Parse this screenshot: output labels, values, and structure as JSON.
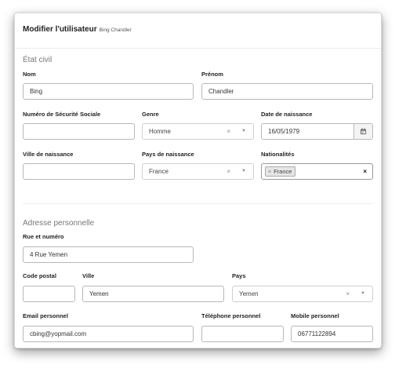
{
  "header": {
    "title": "Modifier l'utilisateur",
    "subtitle": "Bing Chandler"
  },
  "etat_civil": {
    "section_title": "État civil",
    "nom": {
      "label": "Nom",
      "value": "Bing"
    },
    "prenom": {
      "label": "Prénom",
      "value": "Chandler"
    },
    "secu": {
      "label": "Numéro de Sécurité Sociale",
      "value": ""
    },
    "genre": {
      "label": "Genre",
      "value": "Homme",
      "clear": "×",
      "arrow": "▼"
    },
    "date_naissance": {
      "label": "Date de naissance",
      "value": "16/05/1979",
      "icon": "calendar-icon"
    },
    "ville_naissance": {
      "label": "Ville de naissance",
      "value": ""
    },
    "pays_naissance": {
      "label": "Pays de naissance",
      "value": "France",
      "clear": "×",
      "arrow": "▼"
    },
    "nationalites": {
      "label": "Nationalités",
      "tags": [
        "France"
      ],
      "tag_remove": "×",
      "clear_all": "×"
    }
  },
  "adresse": {
    "section_title": "Adresse personnelle",
    "rue": {
      "label": "Rue et numéro",
      "value": "4 Rue Yemen"
    },
    "code_postal": {
      "label": "Code postal",
      "value": ""
    },
    "ville": {
      "label": "Ville",
      "value": "Yemen"
    },
    "pays": {
      "label": "Pays",
      "value": "Yemen",
      "clear": "×",
      "arrow": "▼"
    },
    "email": {
      "label": "Email personnel",
      "value": "cbing@yopmail.com"
    },
    "telephone": {
      "label": "Téléphone personnel",
      "value": ""
    },
    "mobile": {
      "label": "Mobile personnel",
      "value": "06771122894"
    }
  }
}
